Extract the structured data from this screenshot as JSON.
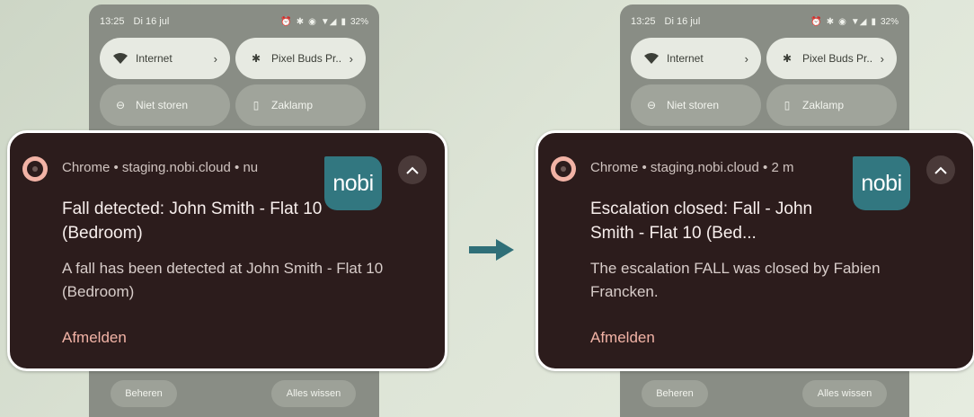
{
  "colors": {
    "page_bg": "#d7dfd0",
    "panel_bg": "#898d85",
    "card_bg": "#2c1c1c",
    "accent": "#f2b3a6",
    "logo_bg": "#327780",
    "arrow": "#2f6f78"
  },
  "screens": [
    {
      "status": {
        "time": "13:25",
        "date": "Di 16 jul",
        "battery": "32%"
      },
      "tiles": {
        "internet": "Internet",
        "buds": "Pixel Buds Pr..",
        "dnd": "Niet storen",
        "torch": "Zaklamp"
      },
      "notification": {
        "meta": "Chrome • staging.nobi.cloud • nu",
        "logo": "nobi",
        "title": "Fall detected: John Smith - Flat 10 (Bedroom)",
        "body": "A fall has been detected at John Smith - Flat 10 (Bedroom)",
        "action": "Afmelden"
      },
      "buttons": {
        "manage": "Beheren",
        "clear": "Alles wissen"
      }
    },
    {
      "status": {
        "time": "13:25",
        "date": "Di 16 jul",
        "battery": "32%"
      },
      "tiles": {
        "internet": "Internet",
        "buds": "Pixel Buds Pr..",
        "dnd": "Niet storen",
        "torch": "Zaklamp"
      },
      "notification": {
        "meta": "Chrome • staging.nobi.cloud • 2 m",
        "logo": "nobi",
        "title": "Escalation closed: Fall - John Smith - Flat 10 (Bed...",
        "body": "The escalation FALL was closed by Fabien Francken.",
        "action": "Afmelden"
      },
      "buttons": {
        "manage": "Beheren",
        "clear": "Alles wissen"
      }
    }
  ],
  "icons": [
    "wifi-icon",
    "bluetooth-icon",
    "dnd-icon",
    "flashlight-icon",
    "alarm-icon",
    "signal-icon",
    "battery-icon",
    "chrome-icon",
    "chevron-up-icon",
    "arrow-right-icon"
  ]
}
